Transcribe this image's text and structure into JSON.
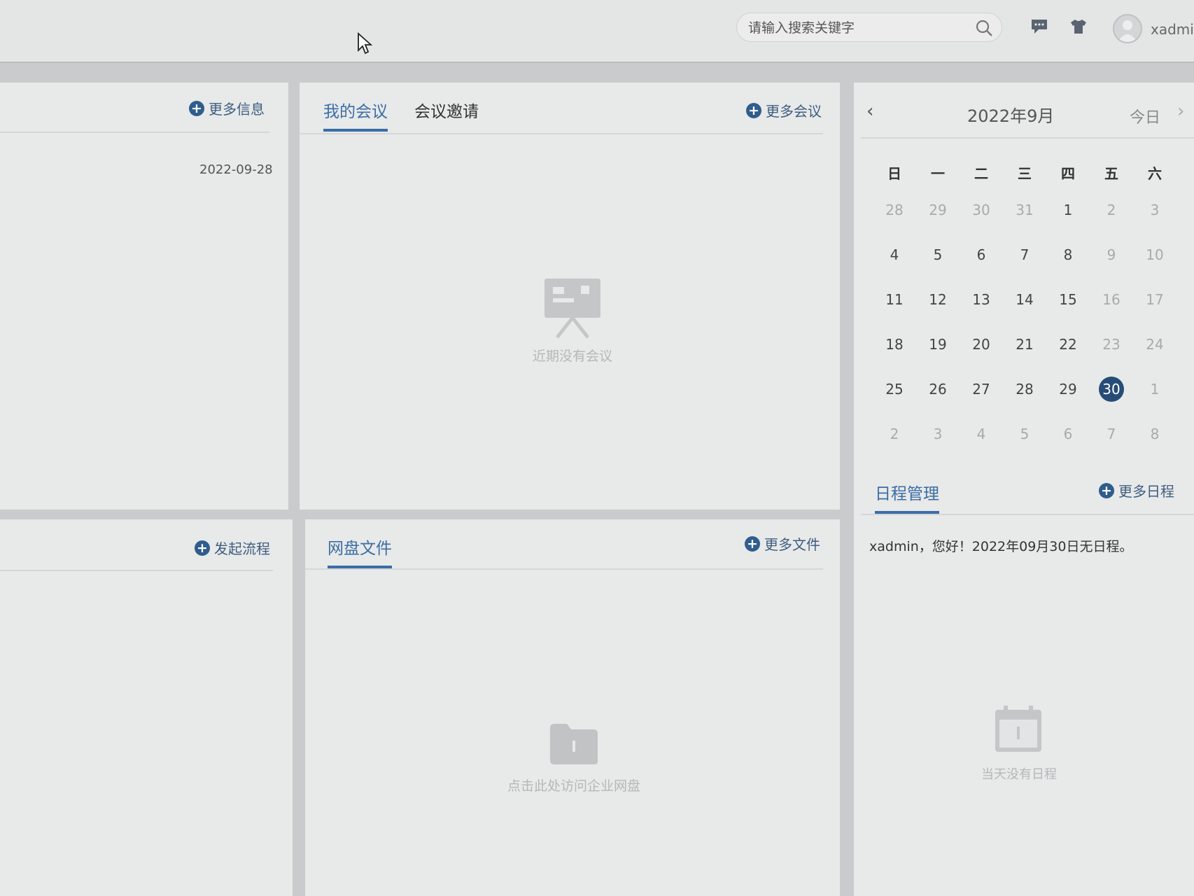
{
  "header": {
    "search_placeholder": "请输入搜索关键字",
    "username": "xadmin"
  },
  "info_panel": {
    "more_label": "更多信息",
    "date": "2022-09-28"
  },
  "meeting_panel": {
    "tabs": [
      {
        "label": "我的会议",
        "active": true
      },
      {
        "label": "会议邀请",
        "active": false
      }
    ],
    "more_label": "更多会议",
    "empty_text": "近期没有会议"
  },
  "calendar": {
    "title": "2022年9月",
    "today_label": "今日",
    "weekdays": [
      "日",
      "一",
      "二",
      "三",
      "四",
      "五",
      "六"
    ],
    "days": [
      {
        "d": "28",
        "other": true
      },
      {
        "d": "29",
        "other": true
      },
      {
        "d": "30",
        "other": true
      },
      {
        "d": "31",
        "other": true
      },
      {
        "d": "1"
      },
      {
        "d": "2",
        "other": true
      },
      {
        "d": "3",
        "other": true
      },
      {
        "d": "4"
      },
      {
        "d": "5"
      },
      {
        "d": "6"
      },
      {
        "d": "7"
      },
      {
        "d": "8"
      },
      {
        "d": "9",
        "other": true
      },
      {
        "d": "10",
        "other": true
      },
      {
        "d": "11"
      },
      {
        "d": "12"
      },
      {
        "d": "13"
      },
      {
        "d": "14"
      },
      {
        "d": "15"
      },
      {
        "d": "16",
        "other": true
      },
      {
        "d": "17",
        "other": true
      },
      {
        "d": "18"
      },
      {
        "d": "19"
      },
      {
        "d": "20"
      },
      {
        "d": "21"
      },
      {
        "d": "22"
      },
      {
        "d": "23",
        "other": true
      },
      {
        "d": "24",
        "other": true
      },
      {
        "d": "25"
      },
      {
        "d": "26"
      },
      {
        "d": "27"
      },
      {
        "d": "28"
      },
      {
        "d": "29"
      },
      {
        "d": "30",
        "today": true
      },
      {
        "d": "1",
        "other": true
      },
      {
        "d": "2",
        "other": true
      },
      {
        "d": "3",
        "other": true
      },
      {
        "d": "4",
        "other": true
      },
      {
        "d": "5",
        "other": true
      },
      {
        "d": "6",
        "other": true
      },
      {
        "d": "7",
        "other": true
      },
      {
        "d": "8",
        "other": true
      }
    ]
  },
  "schedule": {
    "tab_label": "日程管理",
    "more_label": "更多日程",
    "message": "xadmin，您好！2022年09月30日无日程。",
    "empty_text": "当天没有日程"
  },
  "flow_panel": {
    "start_label": "发起流程"
  },
  "disk_panel": {
    "tab_label": "网盘文件",
    "more_label": "更多文件",
    "empty_text": "点击此处访问企业网盘"
  },
  "colors": {
    "accent": "#3a6ea5",
    "today_bg": "#264d76"
  }
}
